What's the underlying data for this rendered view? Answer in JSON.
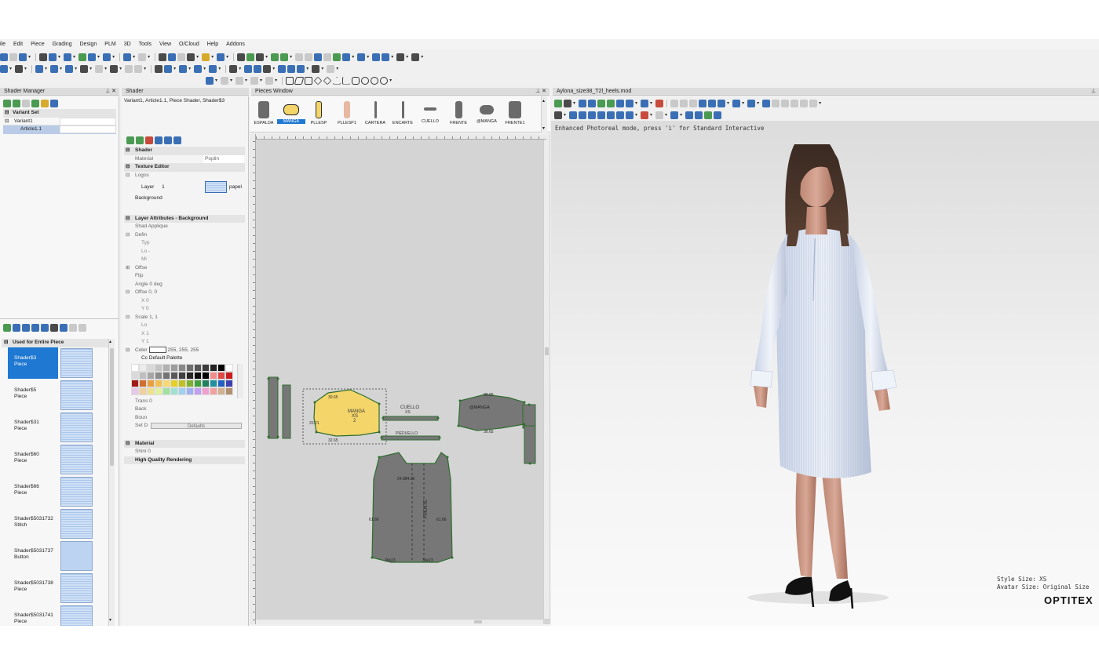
{
  "menu": [
    "ile",
    "Edit",
    "Piece",
    "Grading",
    "Design",
    "PLM",
    "3D",
    "Tools",
    "View",
    "O/Cloud",
    "Help",
    "Addons"
  ],
  "shader_manager": {
    "title": "Shader Manager",
    "tree": [
      {
        "label": "Variant Set",
        "bold": true
      },
      {
        "label": "Variant1"
      },
      {
        "label": "Article1.1",
        "selected": true
      }
    ],
    "list_header": "Used for Entire Piece",
    "shaders": [
      {
        "name": "Shader$3",
        "type": "Piece",
        "active": true
      },
      {
        "name": "Shader$5",
        "type": "Piece"
      },
      {
        "name": "Shader$31",
        "type": "Piece"
      },
      {
        "name": "Shader$60",
        "type": "Piece"
      },
      {
        "name": "Shader$66",
        "type": "Piece"
      },
      {
        "name": "Shader$5031732",
        "type": "Stitch"
      },
      {
        "name": "Shader$5031737",
        "type": "Button"
      },
      {
        "name": "Shader$5031738",
        "type": "Piece"
      },
      {
        "name": "Shader$5031741",
        "type": "Piece"
      }
    ]
  },
  "shader": {
    "title": "Shader",
    "path": "Variant1, Article1.1, Piece Shader, Shader$3",
    "sections": {
      "shader": "Shader",
      "material_label": "Material",
      "material_value": "Poplin",
      "texture_editor": "Texture Editor",
      "logos": "Logos",
      "layer_label": "Layer",
      "layer_value": "1",
      "layer_file": "papel",
      "background": "Background",
      "layer_attributes": "Layer Attributes - Background",
      "shad_applique": "Shad Applique",
      "defin": "Defin",
      "typ": "Typ",
      "lo": "Lo -",
      "mi": "Mi",
      "offse": "Offse",
      "flip": "Flip",
      "angle": "Angle 0 deg",
      "offset2": "Offse 0, 0",
      "x0": "X 0",
      "y0": "Y 0",
      "scale": "Scale 1, 1",
      "lo2": "Lo",
      "x1": "X 1",
      "y1": "Y 1",
      "color_label": "Color",
      "color_value": "255, 255, 255",
      "default_palette": "Cc Default Palette",
      "trans": "Trans 0",
      "back": "Back",
      "boun": "Boun",
      "set": "Set D",
      "defaults_button": "Defaults",
      "material_section": "Material",
      "shini": "Shini 0",
      "hq": "High Quality Rendering"
    },
    "palette": [
      "#ffffff",
      "#ececec",
      "#d8d8d8",
      "#c4c4c4",
      "#b0b0b0",
      "#9c9c9c",
      "#888888",
      "#6e6e6e",
      "#555555",
      "#3c3c3c",
      "#222222",
      "#000000",
      "#ffffff",
      "#d9d9d9",
      "#bfbfbf",
      "#a6a6a6",
      "#8c8c8c",
      "#737373",
      "#595959",
      "#404040",
      "#262626",
      "#0d0d0d",
      "#000000",
      "#f28c8c",
      "#e04848",
      "#c91e1e",
      "#a01818",
      "#d07030",
      "#e8a040",
      "#f2c050",
      "#f8d870",
      "#e8d020",
      "#c0c020",
      "#80b030",
      "#40a040",
      "#208060",
      "#2090a0",
      "#2060c0",
      "#4040b0",
      "#e8c8e8",
      "#f0d0a0",
      "#f0e090",
      "#e0f0a0",
      "#a0e0a0",
      "#a0e0d0",
      "#a0d0f0",
      "#a0b0f0",
      "#c0a0f0",
      "#f0a0d0",
      "#f0a0a0",
      "#d0b090",
      "#b09070"
    ]
  },
  "pieces_window": {
    "title": "Pieces Window",
    "pieces": [
      {
        "name": "ESPALDA"
      },
      {
        "name": "MANGA",
        "active": true
      },
      {
        "name": "PLLESP"
      },
      {
        "name": "PLLESP1"
      },
      {
        "name": "CARTERA"
      },
      {
        "name": "ENCARTE"
      },
      {
        "name": "CUELLO"
      },
      {
        "name": "FRENTE"
      },
      {
        "name": "@MANGA"
      },
      {
        "name": "FRENTE1"
      }
    ],
    "canvas_labels": {
      "cuello": "CUELLO",
      "cuello_size": "XS",
      "pieduello": "PIEDUELLO",
      "manga": "MANGA",
      "manga_size": "XS",
      "manga_qty": "2",
      "manga2": "@MANGA",
      "frente": "FRENTE",
      "m1": "30.65",
      "m2": "20.21",
      "m3": "32.65",
      "m4": "24.884.06",
      "m5": "61.66",
      "m6": "61.66",
      "m7": "30x23",
      "m8": "30x23",
      "m9": "30.65",
      "m10": "30.65"
    }
  },
  "view3d": {
    "title": "Aylona_size38_T2l_heels.mod",
    "mode_text": "Enhanced Photoreal mode, press 'i' for Standard Interactive",
    "style_size": "Style Size: XS",
    "avatar_size": "Avatar Size: Original Size",
    "brand": "OPTITEX"
  },
  "colors": {
    "accent": "#1f78d1",
    "garment": "#eef2f9",
    "piece_grey": "#777777",
    "piece_yellow": "#f3d56a"
  }
}
